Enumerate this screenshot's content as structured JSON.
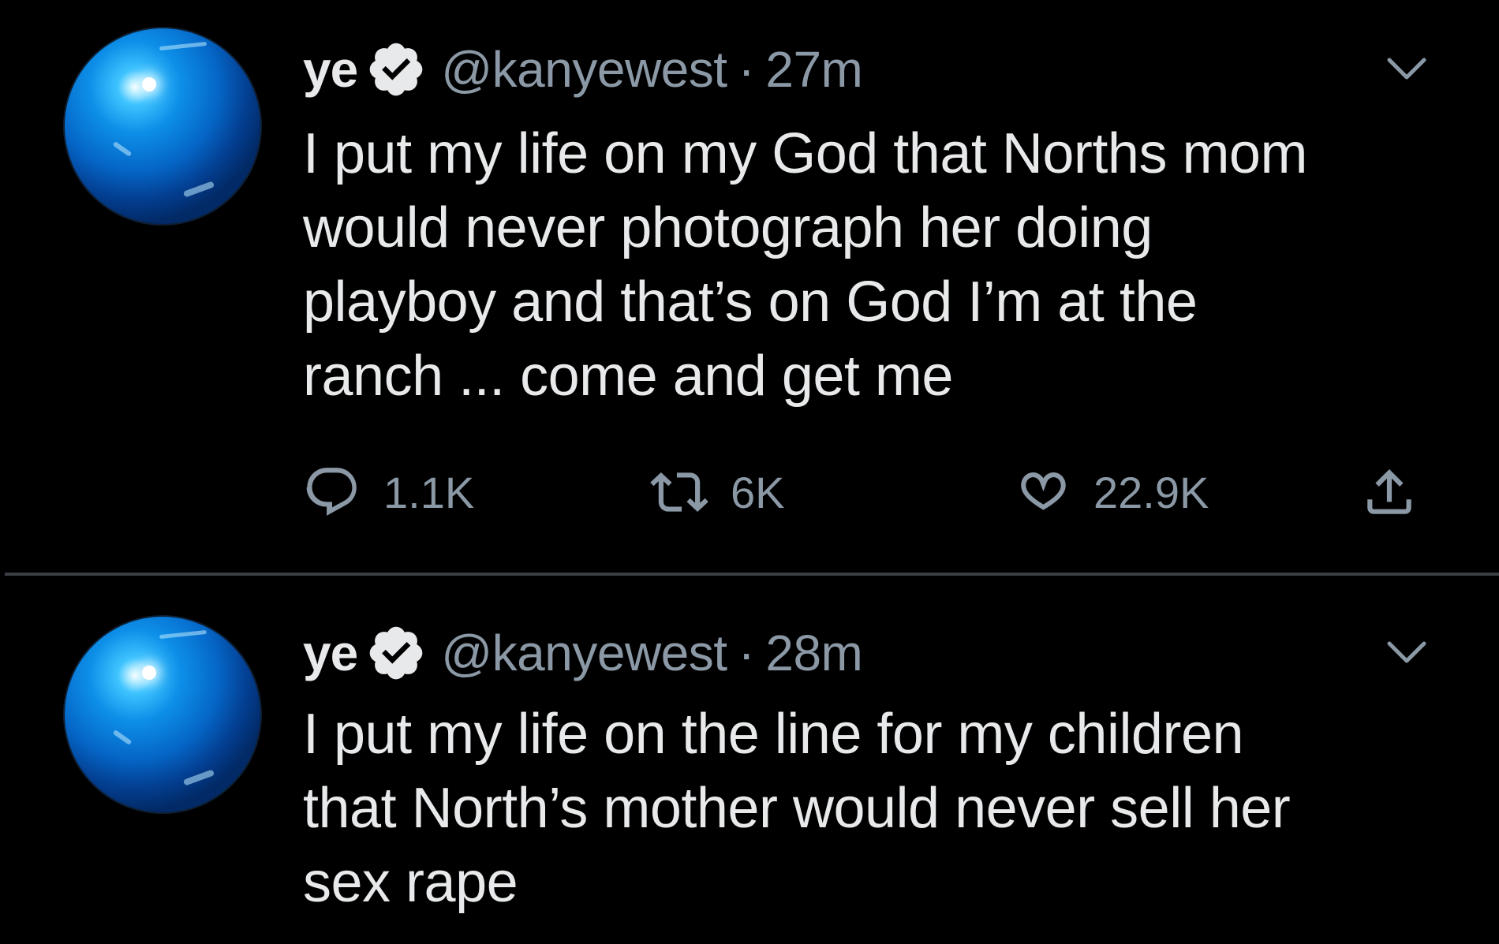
{
  "colors": {
    "background": "#000000",
    "text_primary": "#e7e9ea",
    "text_secondary": "#8b98a5",
    "verified_badge": "#e7e9ea",
    "divider": "#3a3f45"
  },
  "tweets": [
    {
      "display_name": "ye",
      "handle": "@kanyewest",
      "separator": "·",
      "time": "27m",
      "verified": true,
      "avatar_icon": "blue-sphere-avatar",
      "text": "I put my life on my God that Norths mom\nwould never photograph her doing\nplayboy and that’s on God    I’m at the\nranch ... come and get me",
      "actions": {
        "reply": {
          "icon": "reply-icon",
          "count": "1.1K"
        },
        "retweet": {
          "icon": "retweet-icon",
          "count": "6K"
        },
        "like": {
          "icon": "heart-icon",
          "count": "22.9K"
        },
        "share": {
          "icon": "share-icon"
        }
      }
    },
    {
      "display_name": "ye",
      "handle": "@kanyewest",
      "separator": "·",
      "time": "28m",
      "verified": true,
      "avatar_icon": "blue-sphere-avatar",
      "text": "I put my life on the line for my children\nthat North’s mother would never sell her\nsex rape"
    }
  ]
}
